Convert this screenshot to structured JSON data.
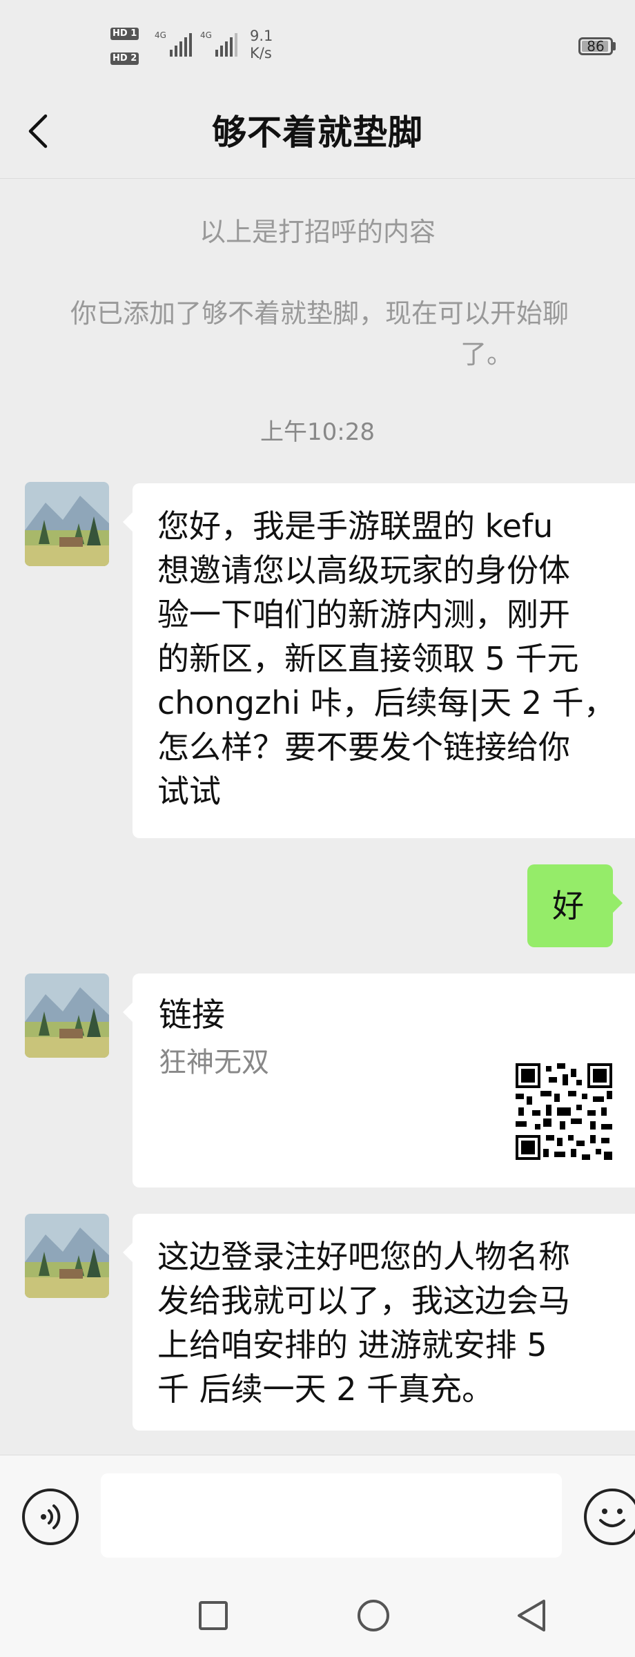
{
  "status_bar": {
    "sim1": "HD 1",
    "sim2": "HD 2",
    "net1": "4G",
    "net2": "4G",
    "speed_value": "9.1",
    "speed_unit": "K/s",
    "battery": "86",
    "battery_level": 0.86
  },
  "header": {
    "title": "够不着就垫脚"
  },
  "system": {
    "greeting_notice": "以上是打招呼的内容",
    "added_notice_line1": "你已添加了够不着就垫脚，现在可以开始聊",
    "added_notice_line2": "了。",
    "timestamp": "上午10:28"
  },
  "messages": [
    {
      "side": "left",
      "text": "您好，我是手游联盟的 kefu\n想邀请您以高级玩家的身份体\n验一下咱们的新游内测，刚开\n的新区，新区直接领取 5 千元\nchongzhi 咔，后续每|天 2 千，\n怎么样？要不要发个链接给你\n试试"
    },
    {
      "side": "right",
      "text": "好"
    },
    {
      "side": "left",
      "type": "link",
      "title": "链接",
      "subtitle": "狂神无双"
    },
    {
      "side": "left",
      "text": "这边登录注好吧您的人物名称\n发给我就可以了，我这边会马\n上给咱安排的 进游就安排 5\n千 后续一天 2 千真充。"
    }
  ],
  "input": {
    "placeholder": "",
    "value": ""
  },
  "icons": {
    "back": "back-arrow-icon",
    "voice": "voice-icon",
    "emoji": "emoji-icon",
    "recent_apps": "square-icon",
    "home": "circle-icon",
    "back_nav": "triangle-back-icon"
  },
  "colors": {
    "background": "#ededed",
    "sent_bubble": "#95ec69",
    "received_bubble": "#ffffff"
  }
}
